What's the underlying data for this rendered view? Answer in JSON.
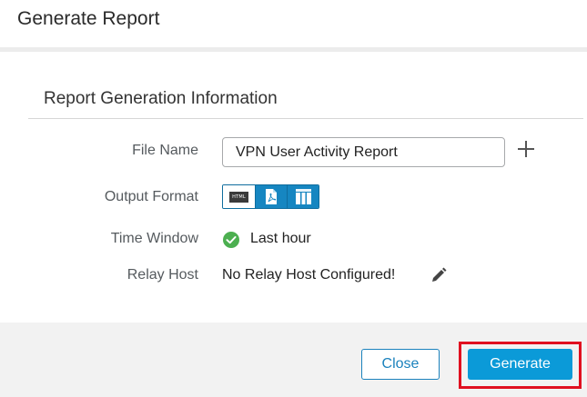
{
  "dialog": {
    "title": "Generate Report"
  },
  "section": {
    "title": "Report Generation Information"
  },
  "form": {
    "file_name_label": "File Name",
    "file_name_value": "VPN User Activity Report",
    "output_format_label": "Output Format",
    "output_formats": [
      {
        "name": "HTML",
        "badge": "HTML",
        "selected": true
      },
      {
        "name": "PDF",
        "icon": "pdf-file-icon",
        "selected": false
      },
      {
        "name": "CSV",
        "icon": "csv-columns-icon",
        "selected": false
      }
    ],
    "time_window_label": "Time Window",
    "time_window_value": "Last hour",
    "relay_host_label": "Relay Host",
    "relay_host_value": "No Relay Host Configured!"
  },
  "footer": {
    "close_label": "Close",
    "generate_label": "Generate"
  },
  "colors": {
    "accent": "#0b9ad8",
    "format_active": "#1686c1",
    "success": "#4caf50",
    "highlight": "#e01020"
  }
}
